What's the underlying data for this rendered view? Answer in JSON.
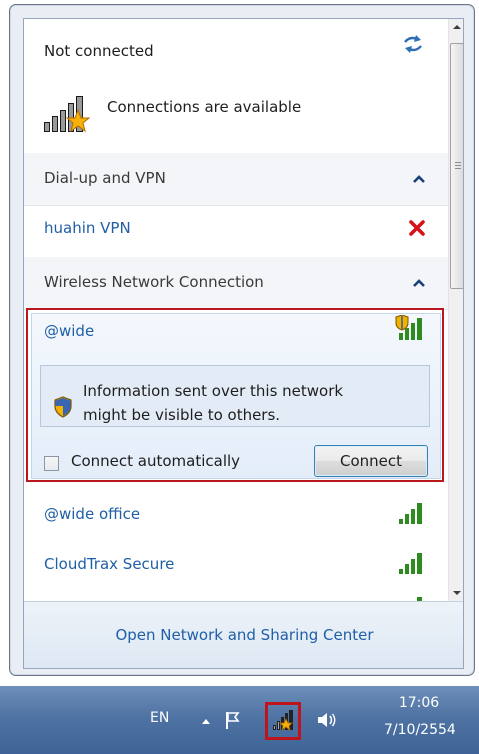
{
  "status": {
    "title": "Not connected",
    "subtitle": "Connections are available"
  },
  "sections": {
    "dialup": {
      "label": "Dial-up and VPN",
      "items": [
        {
          "label": "huahin VPN"
        }
      ]
    },
    "wireless": {
      "label": "Wireless Network Connection",
      "selected": {
        "name": "@wide",
        "warning": "Information sent over this network might be visible to others.",
        "auto_connect_label": "Connect automatically",
        "auto_connect_checked": false,
        "connect_button": "Connect"
      },
      "networks": [
        {
          "name": "@wide office"
        },
        {
          "name": "CloudTrax Secure"
        }
      ]
    }
  },
  "footer": {
    "link": "Open Network and Sharing Center"
  },
  "taskbar": {
    "language": "EN",
    "time": "17:06",
    "date": "7/10/2554"
  },
  "icons": {
    "refresh": "refresh-icon",
    "connections": "signal-with-star-icon",
    "remove": "red-x-icon",
    "shield": "security-shield-icon",
    "signal": "signal-strength-icon"
  },
  "colors": {
    "link": "#1f5fa6",
    "highlight_border": "#b9181f",
    "signal_green": "#2e8b1f",
    "taskbar": "#4f73a3"
  }
}
